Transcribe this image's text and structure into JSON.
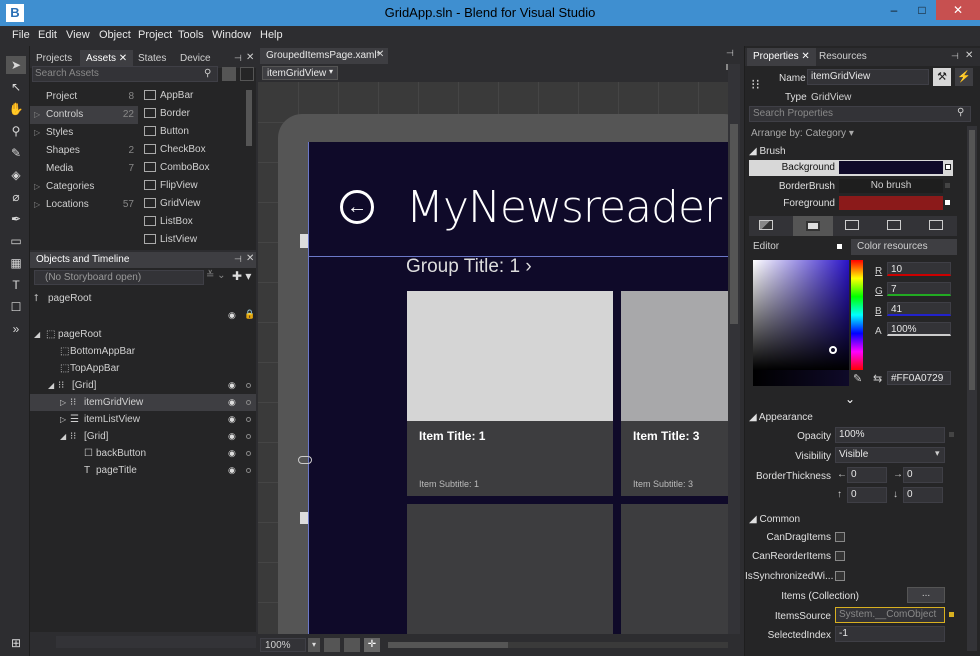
{
  "window": {
    "title": "GridApp.sln - Blend for Visual Studio",
    "minimize": "–",
    "maximize": "□",
    "close": "✕"
  },
  "menu": [
    "File",
    "Edit",
    "View",
    "Object",
    "Project",
    "Tools",
    "Window",
    "Help"
  ],
  "assets_panel": {
    "tabs": [
      "Projects",
      "Assets",
      "States",
      "Device"
    ],
    "search_placeholder": "Search Assets",
    "categories": [
      {
        "label": "Project",
        "count": "8"
      },
      {
        "label": "Controls",
        "count": "22"
      },
      {
        "label": "Styles",
        "count": ""
      },
      {
        "label": "Shapes",
        "count": "2"
      },
      {
        "label": "Media",
        "count": "7"
      },
      {
        "label": "Categories",
        "count": ""
      },
      {
        "label": "Locations",
        "count": "57"
      }
    ],
    "controls": [
      "AppBar",
      "Border",
      "Button",
      "CheckBox",
      "ComboBox",
      "FlipView",
      "GridView",
      "ListBox",
      "ListView"
    ]
  },
  "objects_panel": {
    "title": "Objects and Timeline",
    "storyboard": "(No Storyboard open)",
    "root_label": "pageRoot",
    "tree": [
      {
        "label": "pageRoot"
      },
      {
        "label": "BottomAppBar"
      },
      {
        "label": "TopAppBar"
      },
      {
        "label": "[Grid]"
      },
      {
        "label": "itemGridView"
      },
      {
        "label": "itemListView"
      },
      {
        "label": "[Grid]"
      },
      {
        "label": "backButton"
      },
      {
        "label": "pageTitle"
      }
    ]
  },
  "document": {
    "tab": "GroupedItemsPage.xaml*",
    "element_selector": "itemGridView",
    "zoom": "100%",
    "app_title": "MyNewsreader",
    "group_title": "Group Title: 1 ›",
    "tiles": [
      {
        "title": "Item Title: 1",
        "subtitle": "Item Subtitle: 1"
      },
      {
        "title": "Item Title: 3",
        "subtitle": "Item Subtitle: 3"
      }
    ]
  },
  "properties": {
    "tabs": [
      "Properties",
      "Resources"
    ],
    "name_label": "Name",
    "name_value": "itemGridView",
    "type_label": "Type",
    "type_value": "GridView",
    "search_placeholder": "Search Properties",
    "arrange_by": "Arrange by: Category ▾",
    "brush_section": "Brush",
    "background_label": "Background",
    "borderbrush_label": "BorderBrush",
    "borderbrush_value": "No brush",
    "foreground_label": "Foreground",
    "editor_label": "Editor",
    "color_resources_label": "Color resources",
    "r_label": "R",
    "r_value": "10",
    "g_label": "G",
    "g_value": "7",
    "b_label": "B",
    "b_value": "41",
    "a_label": "A",
    "a_value": "100%",
    "hex_value": "#FF0A0729",
    "appearance_section": "Appearance",
    "opacity_label": "Opacity",
    "opacity_value": "100%",
    "visibility_label": "Visibility",
    "visibility_value": "Visible",
    "borderthickness_label": "BorderThickness",
    "bt_left": "0",
    "bt_right": "0",
    "bt_top": "0",
    "bt_bottom": "0",
    "common_section": "Common",
    "candrag_label": "CanDragItems",
    "canreorder_label": "CanReorderItems",
    "issync_label": "IsSynchronizedWi...",
    "items_label": "Items (Collection)",
    "items_button": "...",
    "itemssource_label": "ItemsSource",
    "itemssource_value": "System.__ComObject",
    "selectedindex_label": "SelectedIndex",
    "selectedindex_value": "-1"
  },
  "colors": {
    "titlebar": "#3f8fd0",
    "page_bg": "#0f0a29",
    "foreground_brush": "#8b1a1a",
    "accent_yellow": "#d8b020"
  }
}
